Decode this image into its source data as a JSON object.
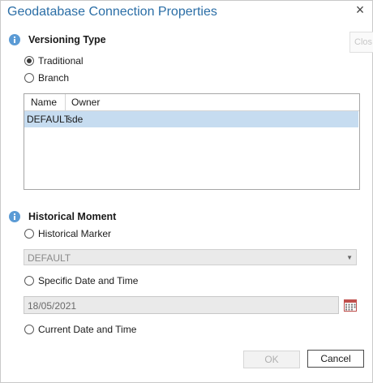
{
  "dialog": {
    "title": "Geodatabase Connection Properties",
    "close_glyph": "×",
    "ghost_tab_label": "Clos"
  },
  "versioning": {
    "heading": "Versioning Type",
    "options": [
      {
        "label": "Traditional",
        "selected": true
      },
      {
        "label": "Branch",
        "selected": false
      }
    ],
    "table": {
      "columns": [
        "Name",
        "Owner"
      ],
      "rows": [
        {
          "name": "DEFAULT",
          "owner": "sde",
          "selected": true
        }
      ]
    }
  },
  "historical": {
    "heading": "Historical Moment",
    "marker_option": {
      "label": "Historical Marker",
      "selected": false
    },
    "marker_value": "DEFAULT",
    "date_option": {
      "label": "Specific Date and Time",
      "selected": false
    },
    "date_value": "18/05/2021",
    "current_option": {
      "label": "Current Date and Time",
      "selected": false
    }
  },
  "buttons": {
    "ok": "OK",
    "cancel": "Cancel"
  },
  "colors": {
    "title": "#2b6ea6",
    "info_icon": "#5b9bd5",
    "selection": "#c6dcf0"
  },
  "icons": {
    "section": "info-icon",
    "calendar": "calendar-icon",
    "dropdown": "chevron-down-icon",
    "close": "close-icon"
  }
}
